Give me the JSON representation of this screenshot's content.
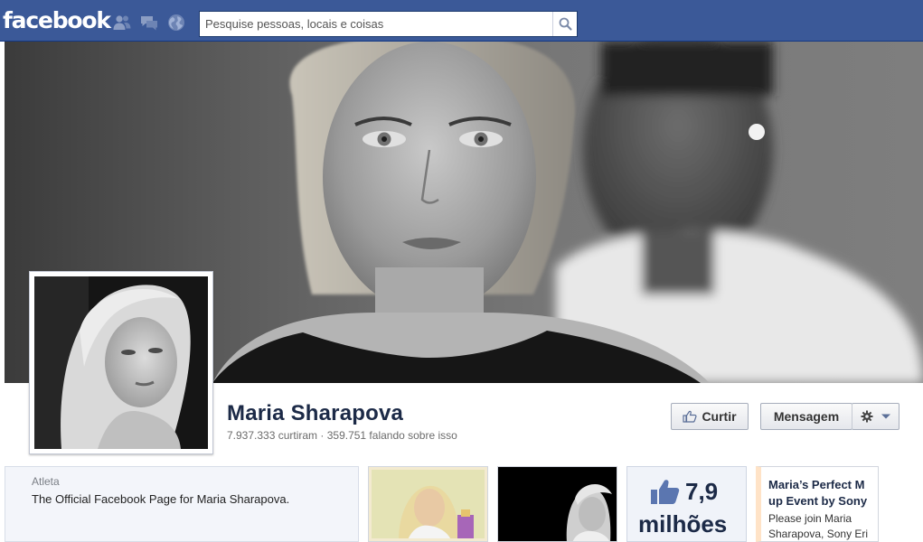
{
  "app": {
    "logo": "facebook",
    "icons": [
      "friends-icon",
      "messages-icon",
      "notifications-globe-icon",
      "search-icon"
    ]
  },
  "search": {
    "placeholder": "Pesquise pessoas, locais e coisas"
  },
  "profile": {
    "name": "Maria Sharapova",
    "stats": "7.937.333 curtiram · 359.751 falando sobre isso"
  },
  "actions": {
    "like_label": "Curtir",
    "message_label": "Mensagem"
  },
  "about": {
    "category": "Atleta",
    "description": "The Official Facebook Page for Maria Sharapova."
  },
  "likes_box": {
    "count": "7,9",
    "unit": "milhões"
  },
  "event": {
    "line1": "Maria’s Perfect M",
    "line2": "up Event by Sony",
    "line3": "Please join Maria",
    "line4": "Sharapova, Sony Eri"
  },
  "colors": {
    "brand": "#3b5998",
    "name_text": "#1c2a47"
  }
}
